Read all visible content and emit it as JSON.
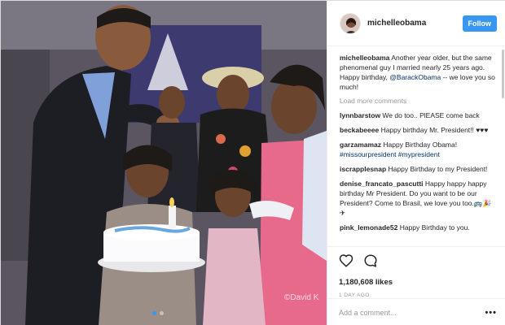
{
  "post": {
    "username": "michelleobama",
    "follow_label": "Follow",
    "photo_alt": "Birthday photo",
    "watermark": "©David K",
    "carousel": {
      "count": 2,
      "active": 1
    }
  },
  "caption": {
    "user": "michelleobama",
    "text_before": " Another year older, but the same phenomenal guy I married nearly 25 years ago. Happy birthday, ",
    "mention": "@BarackObama",
    "text_after": " -- we love you so much!"
  },
  "load_more_label": "Load more comments",
  "comments": [
    {
      "user": "lynnbarstow",
      "text": " We do too.. PlEASE come back"
    },
    {
      "user": "beckabeeee",
      "text": " Happy birthday Mr. President!! ♥♥♥"
    },
    {
      "user": "garzamamaz",
      "text": " Happy Birthday Obama!",
      "tags": "#missourpresident #mypresident"
    },
    {
      "user": "iscrapplesnap",
      "text": " Happy Birthday to my President!"
    },
    {
      "user": "denise_francato_pascutti",
      "text": " Happy happy happy birthday Mr President. Do you want to be our President? Come to Brasil, we love you too.🚌🎉✈"
    },
    {
      "user": "pink_lemonade52",
      "text": " Happy Birthday to you."
    }
  ],
  "actions": {
    "like_icon": "heart-icon",
    "comment_icon": "comment-bubble-icon",
    "likes": "1,180,608 likes",
    "timestamp": "1 DAY AGO"
  },
  "add_comment": {
    "placeholder": "Add a comment...",
    "more_label": "•••"
  },
  "colors": {
    "accent": "#3897f0",
    "mention": "#003569",
    "muted": "#999999",
    "border": "#efefef"
  }
}
